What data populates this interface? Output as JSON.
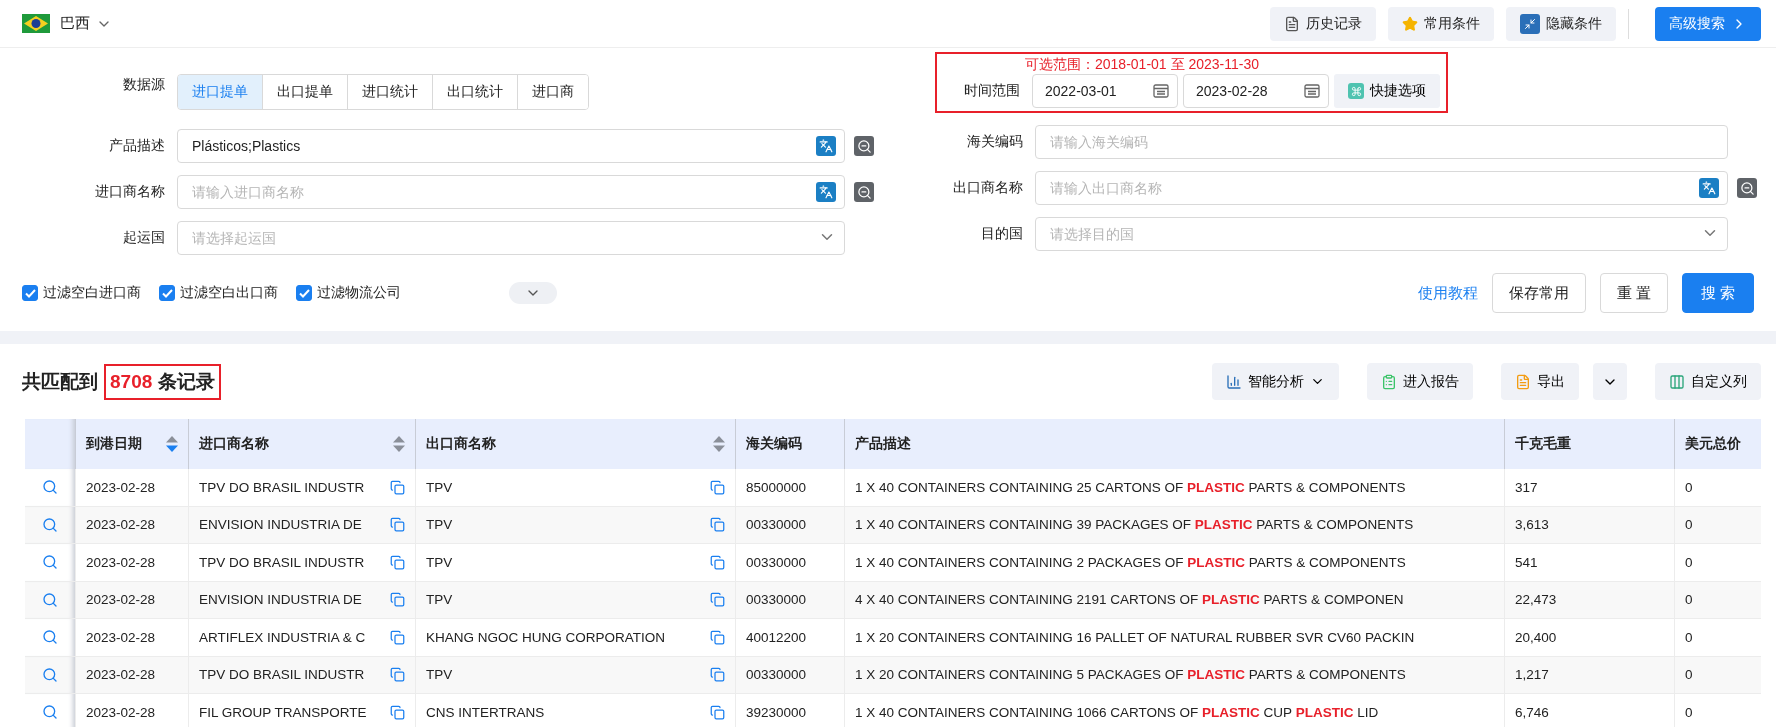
{
  "topbar": {
    "country": "巴西",
    "buttons": [
      {
        "label": "历史记录",
        "kind": "history"
      },
      {
        "label": "常用条件",
        "kind": "star"
      },
      {
        "label": "隐藏条件",
        "kind": "hide"
      },
      {
        "label": "高级搜索",
        "kind": "primary"
      }
    ]
  },
  "filters": {
    "data_source": {
      "label": "数据源",
      "tabs": [
        {
          "label": "进口提单",
          "selected": true
        },
        {
          "label": "出口提单",
          "selected": false
        },
        {
          "label": "进口统计",
          "selected": false
        },
        {
          "label": "出口统计",
          "selected": false
        },
        {
          "label": "进口商",
          "selected": false
        }
      ]
    },
    "left_fields": [
      {
        "label": "产品描述",
        "kind": "translate",
        "value": "Plásticos;Plastics"
      },
      {
        "label": "进口商名称",
        "kind": "translate",
        "placeholder": "请输入进口商名称"
      },
      {
        "label": "起运国",
        "kind": "select",
        "placeholder": "请选择起运国"
      }
    ],
    "time_range": {
      "hint": "可选范围：2018-01-01 至 2023-11-30",
      "label": "时间范围",
      "start": "2022-03-01",
      "end": "2023-02-28",
      "quick": "快捷选项"
    },
    "right_fields": [
      {
        "label": "海关编码",
        "kind": "text",
        "placeholder": "请输入海关编码"
      },
      {
        "label": "出口商名称",
        "kind": "translate",
        "placeholder": "请输入出口商名称"
      },
      {
        "label": "目的国",
        "kind": "select",
        "placeholder": "请选择目的国"
      }
    ],
    "checkboxes": [
      {
        "label": "过滤空白进口商",
        "checked": true
      },
      {
        "label": "过滤空白出口商",
        "checked": true
      },
      {
        "label": "过滤物流公司",
        "checked": true
      }
    ],
    "expand_toggle": {
      "expanded": false
    },
    "actions": [
      {
        "label": "使用教程",
        "kind": "link"
      },
      {
        "label": "保存常用",
        "kind": "default"
      },
      {
        "label": "重 置",
        "kind": "default"
      },
      {
        "label": "搜 索",
        "kind": "primary"
      }
    ]
  },
  "results": {
    "prefix": "共匹配到",
    "count": "8708",
    "suffix": "条记录",
    "tools": [
      {
        "label": "智能分析",
        "kind": "analysis"
      },
      {
        "label": "进入报告",
        "kind": "report"
      },
      {
        "label": "导出",
        "kind": "export"
      },
      {
        "label": "自定义列",
        "kind": "columns"
      }
    ]
  },
  "table": {
    "columns": [
      {
        "label": "到港日期",
        "kind": "sortable",
        "sorted": true
      },
      {
        "label": "进口商名称",
        "kind": "sortable",
        "sorted": false
      },
      {
        "label": "出口商名称",
        "kind": "sortable",
        "sorted": false
      },
      {
        "label": "海关编码",
        "kind": "plain"
      },
      {
        "label": "产品描述",
        "kind": "plain"
      },
      {
        "label": "千克毛重",
        "kind": "plain"
      },
      {
        "label": "美元总价",
        "kind": "plain"
      }
    ],
    "rows": [
      {
        "date": "2023-02-28",
        "importer": "TPV DO BRASIL INDUSTR",
        "exporter": "TPV",
        "hs_code": "85000000",
        "description": "1 X 40 CONTAINERS CONTAINING 25 CARTONS OF **PLASTIC** PARTS & COMPONENTS",
        "weight": "317",
        "usd": "0"
      },
      {
        "date": "2023-02-28",
        "importer": "ENVISION INDUSTRIA DE",
        "exporter": "TPV",
        "hs_code": "00330000",
        "description": "1 X 40 CONTAINERS CONTAINING 39 PACKAGES OF **PLASTIC** PARTS & COMPONENTS",
        "weight": "3,613",
        "usd": "0"
      },
      {
        "date": "2023-02-28",
        "importer": "TPV DO BRASIL INDUSTR",
        "exporter": "TPV",
        "hs_code": "00330000",
        "description": "1 X 40 CONTAINERS CONTAINING 2 PACKAGES OF **PLASTIC** PARTS & COMPONENTS",
        "weight": "541",
        "usd": "0"
      },
      {
        "date": "2023-02-28",
        "importer": "ENVISION INDUSTRIA DE",
        "exporter": "TPV",
        "hs_code": "00330000",
        "description": "4 X 40 CONTAINERS CONTAINING 2191 CARTONS OF **PLASTIC** PARTS & COMPONEN",
        "weight": "22,473",
        "usd": "0"
      },
      {
        "date": "2023-02-28",
        "importer": "ARTIFLEX INDUSTRIA & C",
        "exporter": "KHANG NGOC HUNG CORPORATION",
        "hs_code": "40012200",
        "description": "1 X 20 CONTAINERS CONTAINING 16 PALLET OF NATURAL RUBBER SVR CV60 PACKIN",
        "weight": "20,400",
        "usd": "0"
      },
      {
        "date": "2023-02-28",
        "importer": "TPV DO BRASIL INDUSTR",
        "exporter": "TPV",
        "hs_code": "00330000",
        "description": "1 X 20 CONTAINERS CONTAINING 5 PACKAGES OF **PLASTIC** PARTS & COMPONENTS",
        "weight": "1,217",
        "usd": "0"
      },
      {
        "date": "2023-02-28",
        "importer": "FIL GROUP TRANSPORTE",
        "exporter": "CNS INTERTRANS",
        "hs_code": "39230000",
        "description": "1 X 40 CONTAINERS CONTAINING 1066 CARTONS OF **PLASTIC** CUP **PLASTIC** LID",
        "weight": "6,746",
        "usd": "0"
      }
    ]
  }
}
